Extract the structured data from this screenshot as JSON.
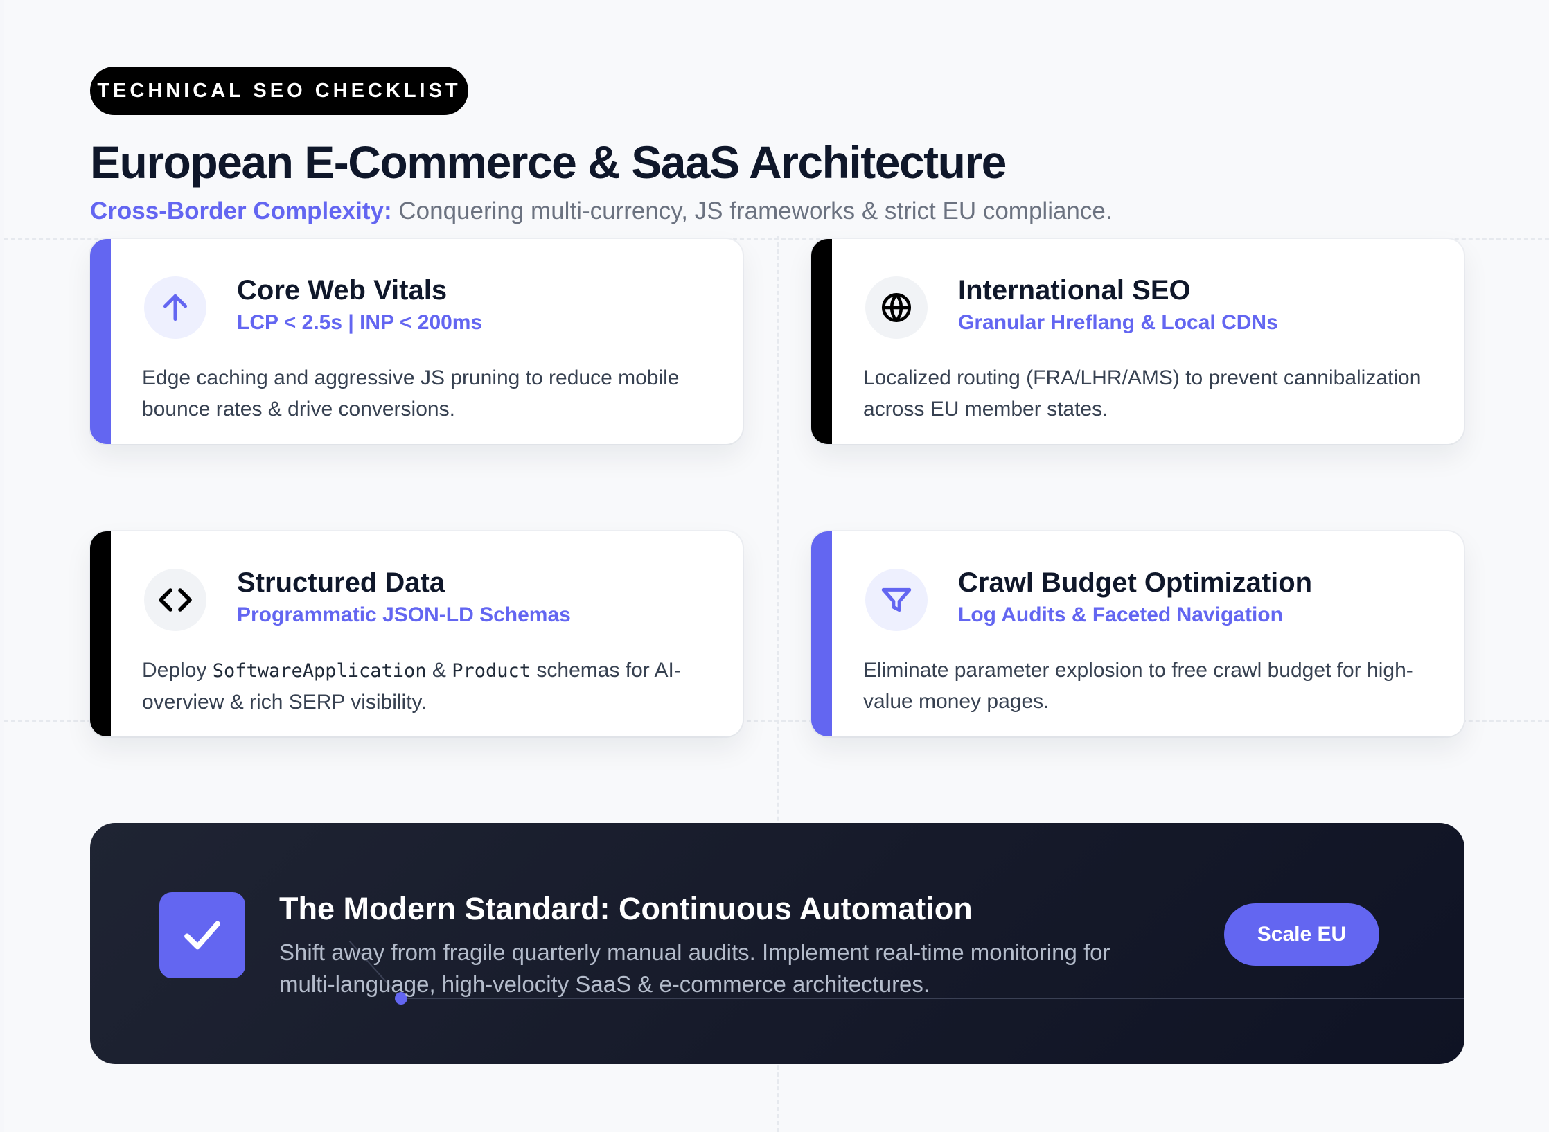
{
  "header": {
    "badge": "TECHNICAL SEO CHECKLIST",
    "title": "European E-Commerce & SaaS Architecture",
    "subtitle_lead": "Cross-Border Complexity:",
    "subtitle_rest": " Conquering multi-currency, JS frameworks & strict EU compliance."
  },
  "cards": [
    {
      "title": "Core Web Vitals",
      "subtitle": "LCP < 2.5s | INP < 200ms",
      "description": "Edge caching and aggressive JS pruning to reduce mobile bounce rates & drive conversions.",
      "icon": "arrow-up-icon",
      "accent": "#6366f1"
    },
    {
      "title": "International SEO",
      "subtitle": "Granular Hreflang & Local CDNs",
      "description": "Localized routing (FRA/LHR/AMS) to prevent cannibalization across EU member states.",
      "icon": "globe-icon",
      "accent": "#000000"
    },
    {
      "title": "Structured Data",
      "subtitle": "Programmatic JSON-LD Schemas",
      "desc_prefix": "Deploy ",
      "desc_code1": "SoftwareApplication",
      "desc_mid": " & ",
      "desc_code2": "Product",
      "desc_suffix": " schemas for AI-overview & rich SERP visibility.",
      "icon": "code-brackets-icon",
      "accent": "#000000"
    },
    {
      "title": "Crawl Budget Optimization",
      "subtitle": "Log Audits & Faceted Navigation",
      "description": "Eliminate parameter explosion to free crawl budget for high-value money pages.",
      "icon": "filter-funnel-icon",
      "accent": "#6366f1"
    }
  ],
  "banner": {
    "title": "The Modern Standard: Continuous Automation",
    "description": "Shift away from fragile quarterly manual audits. Implement real-time monitoring for multi-language, high-velocity SaaS & e-commerce architectures.",
    "cta_label": "Scale EU",
    "icon": "checkmark-icon"
  },
  "colors": {
    "accent": "#6366f1",
    "dark": "#0f172a"
  }
}
